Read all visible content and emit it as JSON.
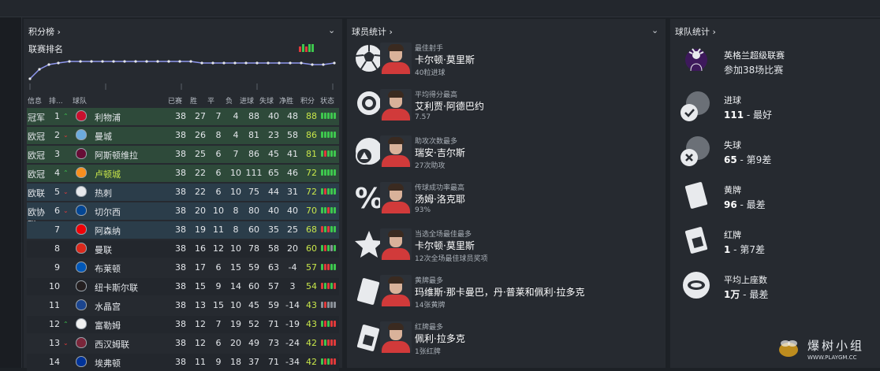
{
  "league": {
    "title": "积分榜",
    "subtitle": "联赛排名",
    "headers": [
      "信息",
      "排...",
      "球队",
      "已赛",
      "胜",
      "平",
      "负",
      "进球",
      "失球",
      "净胜",
      "积分",
      "状态"
    ],
    "rows": [
      {
        "info": "冠军",
        "pos": "1",
        "move": "^",
        "team": "利物浦",
        "p": "38",
        "w": "27",
        "d": "7",
        "l": "4",
        "gf": "88",
        "ga": "40",
        "gd": "48",
        "pts": "88",
        "crest": "#c8102e",
        "form": "WWWWW"
      },
      {
        "info": "欧冠",
        "pos": "2",
        "move": "v",
        "team": "曼城",
        "p": "38",
        "w": "26",
        "d": "8",
        "l": "4",
        "gf": "81",
        "ga": "23",
        "gd": "58",
        "pts": "86",
        "crest": "#6cabdd",
        "form": "WWWWW"
      },
      {
        "info": "欧冠",
        "pos": "3",
        "move": "",
        "team": "阿斯顿维拉",
        "p": "38",
        "w": "25",
        "d": "6",
        "l": "7",
        "gf": "86",
        "ga": "45",
        "gd": "41",
        "pts": "81",
        "crest": "#670e36",
        "form": "WLWWW"
      },
      {
        "info": "欧冠",
        "pos": "4",
        "move": "^",
        "team": "卢顿城",
        "p": "38",
        "w": "22",
        "d": "6",
        "l": "10",
        "gf": "111",
        "ga": "65",
        "gd": "46",
        "pts": "72",
        "crest": "#f78f1e",
        "form": "WWWWW"
      },
      {
        "info": "欧联",
        "pos": "5",
        "move": "v",
        "team": "热刺",
        "p": "38",
        "w": "22",
        "d": "6",
        "l": "10",
        "gf": "75",
        "ga": "44",
        "gd": "31",
        "pts": "72",
        "crest": "#e6e8ec",
        "form": "WLWWW"
      },
      {
        "info": "欧协联",
        "pos": "6",
        "move": "v",
        "team": "切尔西",
        "p": "38",
        "w": "20",
        "d": "10",
        "l": "8",
        "gf": "80",
        "ga": "40",
        "gd": "40",
        "pts": "70",
        "crest": "#034694",
        "form": "WWLWW"
      },
      {
        "info": "",
        "pos": "7",
        "move": "",
        "team": "阿森纳",
        "p": "38",
        "w": "19",
        "d": "11",
        "l": "8",
        "gf": "60",
        "ga": "35",
        "gd": "25",
        "pts": "68",
        "crest": "#ef0107",
        "form": "LWLWW"
      },
      {
        "info": "",
        "pos": "8",
        "move": "",
        "team": "曼联",
        "p": "38",
        "w": "16",
        "d": "12",
        "l": "10",
        "gf": "78",
        "ga": "58",
        "gd": "20",
        "pts": "60",
        "crest": "#da291c",
        "form": "WLWDW"
      },
      {
        "info": "",
        "pos": "9",
        "move": "",
        "team": "布莱顿",
        "p": "38",
        "w": "17",
        "d": "6",
        "l": "15",
        "gf": "59",
        "ga": "63",
        "gd": "-4",
        "pts": "57",
        "crest": "#0057b8",
        "form": "WLLWW"
      },
      {
        "info": "",
        "pos": "10",
        "move": "",
        "team": "纽卡斯尔联",
        "p": "38",
        "w": "15",
        "d": "9",
        "l": "14",
        "gf": "60",
        "ga": "57",
        "gd": "3",
        "pts": "54",
        "crest": "#241f20",
        "form": "LWLWL"
      },
      {
        "info": "",
        "pos": "11",
        "move": "",
        "team": "水晶宫",
        "p": "38",
        "w": "13",
        "d": "15",
        "l": "10",
        "gf": "45",
        "ga": "59",
        "gd": "-14",
        "pts": "43",
        "crest": "#1b458f",
        "form": "DLDDD"
      },
      {
        "info": "",
        "pos": "12",
        "move": "^",
        "team": "富勒姆",
        "p": "38",
        "w": "12",
        "d": "7",
        "l": "19",
        "gf": "52",
        "ga": "71",
        "gd": "-19",
        "pts": "43",
        "crest": "#f0f0f0",
        "form": "WLWLL"
      },
      {
        "info": "",
        "pos": "13",
        "move": "v",
        "team": "西汉姆联",
        "p": "38",
        "w": "12",
        "d": "6",
        "l": "20",
        "gf": "49",
        "ga": "73",
        "gd": "-24",
        "pts": "42",
        "crest": "#7a263a",
        "form": "LWLLL"
      },
      {
        "info": "",
        "pos": "14",
        "move": "",
        "team": "埃弗顿",
        "p": "38",
        "w": "11",
        "d": "9",
        "l": "18",
        "gf": "37",
        "ga": "71",
        "gd": "-34",
        "pts": "42",
        "crest": "#003399",
        "form": "WLWLL"
      }
    ]
  },
  "players": {
    "title": "球员统计",
    "cards": [
      {
        "label": "最佳射手",
        "name": "卡尔顿·莫里斯",
        "value": "40粒进球",
        "icon": "football-icon"
      },
      {
        "label": "平均得分最高",
        "name": "艾利贾·阿德巴约",
        "value": "7.57",
        "icon": "rating-badge-icon"
      },
      {
        "label": "助攻次数最多",
        "name": "瑞安·吉尔斯",
        "value": "27次助攻",
        "icon": "assist-icon"
      },
      {
        "label": "传球成功率最高",
        "name": "汤姆·洛克耶",
        "value": "93%",
        "icon": "percent-icon"
      },
      {
        "label": "当选全场最佳最多",
        "name": "卡尔顿·莫里斯",
        "value": "12次全场最佳球员奖项",
        "icon": "star-icon"
      },
      {
        "label": "黄牌最多",
        "name": "玛维斯·那卡曼巴，丹·普莱和佩利·拉多克",
        "value": "14张黄牌",
        "icon": "yellow-card-icon"
      },
      {
        "label": "红牌最多",
        "name": "佩利·拉多克",
        "value": "1张红牌",
        "icon": "red-card-icon"
      }
    ]
  },
  "team": {
    "title": "球队统计",
    "items": [
      {
        "label": "英格兰超级联赛",
        "value": "参加38场比赛",
        "strong": "",
        "icon": "premier-league-logo"
      },
      {
        "label": "进球",
        "value": " - 最好",
        "strong": "111",
        "icon": "goals-icon"
      },
      {
        "label": "失球",
        "value": " - 第9差",
        "strong": "65",
        "icon": "conceded-icon"
      },
      {
        "label": "黄牌",
        "value": " - 最差",
        "strong": "96",
        "icon": "yellow-card-icon"
      },
      {
        "label": "红牌",
        "value": " - 第7差",
        "strong": "1",
        "icon": "red-card-icon"
      },
      {
        "label": "平均上座数",
        "value": " - 最差",
        "strong": "1万",
        "icon": "stadium-icon"
      }
    ]
  },
  "colors": {
    "green_zone": "#2e4a3a",
    "blue_zone": "#2b3d4a",
    "highlight": "#c8e64a"
  },
  "watermark": {
    "text": "爆树小组",
    "url": "WWW.PLAYGM.CC"
  }
}
